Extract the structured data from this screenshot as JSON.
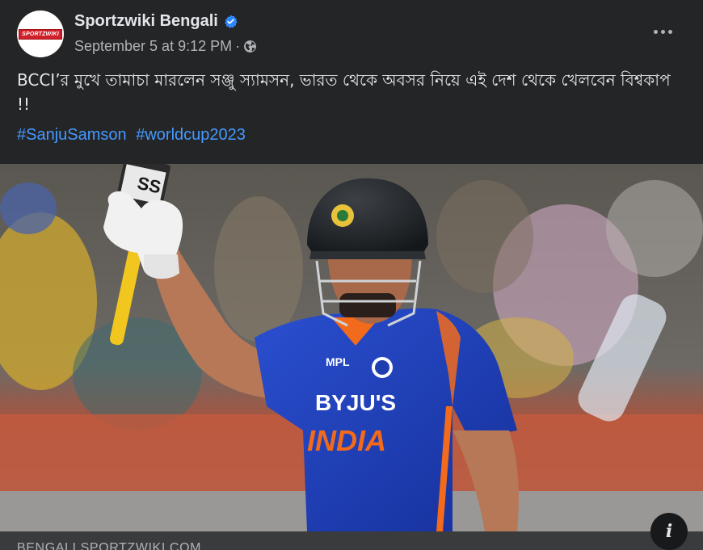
{
  "post": {
    "author": "Sportzwiki Bengali",
    "avatar_text": "SPORTZWIKI",
    "timestamp": "September 5 at 9:12 PM",
    "separator": "·",
    "audience_icon": "globe-icon",
    "verified_icon": "verified-badge-icon",
    "more_icon": "more-options-icon",
    "text": "BCCI’র মুখে তামাচা মারলেন সঞ্জু স্যামসন, ভারত থেকে অবসর নিয়ে এই দেশ থেকে খেলবেন বিশ্বকাপ !!",
    "hashtags": [
      "#SanjuSamson",
      "#worldcup2023"
    ]
  },
  "photo": {
    "jersey_sponsor": "BYJU'S",
    "jersey_country": "INDIA",
    "jersey_brand": "MPL",
    "bat_logo": "SS"
  },
  "link": {
    "domain": "BENGALI.SPORTZWIKI.COM",
    "info_icon": "info-icon"
  },
  "colors": {
    "background": "#242526",
    "text": "#e4e6eb",
    "secondary_text": "#b0b3b8",
    "hashtag": "#4599ff",
    "verified": "#2d88ff",
    "jersey_blue": "#1f3fae",
    "jersey_orange": "#f26a1b"
  }
}
